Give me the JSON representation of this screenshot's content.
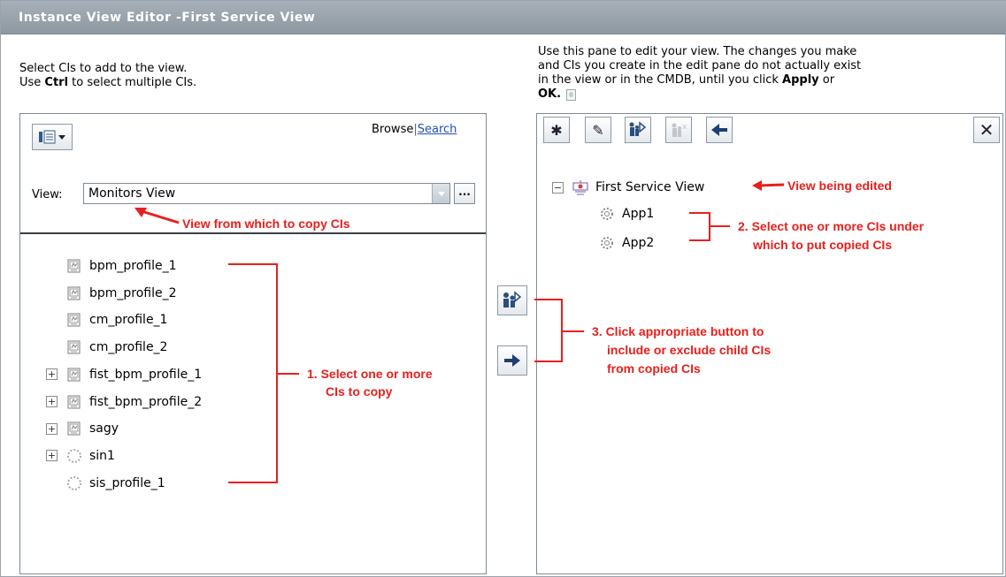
{
  "window": {
    "title": "Instance View Editor -First Service View"
  },
  "left_instructions": {
    "line1": "Select CIs to add to the view.",
    "line2_pre": "Use ",
    "line2_key": "Ctrl",
    "line2_post": " to select multiple CIs."
  },
  "right_instructions": {
    "line1": "Use this pane to edit your view. The changes you make",
    "line2": "and CIs you create in the edit pane do not actually exist",
    "line3_pre": "in the view or in the CMDB, until you click ",
    "line3_apply": "Apply",
    "line3_post": " or",
    "line4_ok": "OK."
  },
  "left_pane": {
    "browse_label": "Browse",
    "search_label": "Search",
    "view_label": "View:",
    "view_value": "Monitors View",
    "more_label": "...",
    "tree": [
      {
        "label": "bpm_profile_1",
        "expandable": false,
        "icon": "monitor-icon"
      },
      {
        "label": "bpm_profile_2",
        "expandable": false,
        "icon": "monitor-icon"
      },
      {
        "label": "cm_profile_1",
        "expandable": false,
        "icon": "monitor-icon"
      },
      {
        "label": "cm_profile_2",
        "expandable": false,
        "icon": "monitor-icon"
      },
      {
        "label": "fist_bpm_profile_1",
        "expandable": true,
        "icon": "monitor-icon"
      },
      {
        "label": "fist_bpm_profile_2",
        "expandable": true,
        "icon": "monitor-icon"
      },
      {
        "label": "sagy",
        "expandable": true,
        "icon": "monitor-icon"
      },
      {
        "label": "sin1",
        "expandable": true,
        "icon": "dotted-circle-icon"
      },
      {
        "label": "sis_profile_1",
        "expandable": false,
        "icon": "dotted-circle-icon"
      }
    ]
  },
  "right_pane": {
    "root": {
      "label": "First Service View",
      "expander": "−"
    },
    "children": [
      {
        "label": "App1"
      },
      {
        "label": "App2"
      }
    ]
  },
  "annotations": {
    "view_copy": "View from which to copy CIs",
    "select_cis_1": "1. Select one or more",
    "select_cis_2": "CIs to copy",
    "view_edited": "View being edited",
    "select_under_1": "2. Select one or more CIs under",
    "select_under_2": "which to put copied CIs",
    "click_btn_1": "3. Click appropriate button to",
    "click_btn_2": "include or exclude child CIs",
    "click_btn_3": "from copied CIs"
  },
  "colors": {
    "annotation": "#e8201c",
    "title_bar": "#98a2ac",
    "link": "#1f4fb8"
  }
}
